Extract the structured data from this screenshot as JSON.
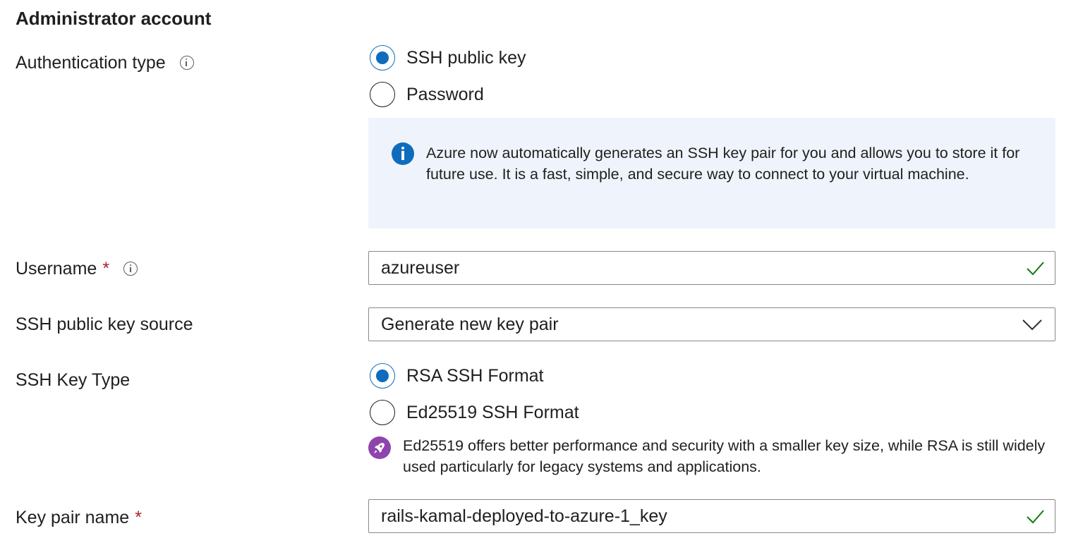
{
  "section": {
    "title": "Administrator account"
  },
  "auth": {
    "label": "Authentication type",
    "options": [
      {
        "label": "SSH public key",
        "checked": true
      },
      {
        "label": "Password",
        "checked": false
      }
    ],
    "info_text": "Azure now automatically generates an SSH key pair for you and allows you to store it for future use. It is a fast, simple, and secure way to connect to your virtual machine."
  },
  "username": {
    "label": "Username",
    "required_mark": "*",
    "value": "azureuser"
  },
  "key_source": {
    "label": "SSH public key source",
    "value": "Generate new key pair"
  },
  "key_type": {
    "label": "SSH Key Type",
    "options": [
      {
        "label": "RSA SSH Format",
        "checked": true
      },
      {
        "label": "Ed25519 SSH Format",
        "checked": false
      }
    ],
    "note": "Ed25519 offers better performance and security with a smaller key size, while RSA is still widely used particularly for legacy systems and applications."
  },
  "key_pair_name": {
    "label": "Key pair name",
    "required_mark": "*",
    "value": "rails-kamal-deployed-to-azure-1_key"
  },
  "colors": {
    "accent": "#0f6cbd",
    "valid_check": "#107c10",
    "required": "#a4262c",
    "info_background": "#eff4fc",
    "rocket_badge": "#8e44ad"
  },
  "icons": {
    "info": "info-icon",
    "valid": "checkmark-icon",
    "dropdown": "chevron-down-icon",
    "note": "rocket-icon"
  }
}
